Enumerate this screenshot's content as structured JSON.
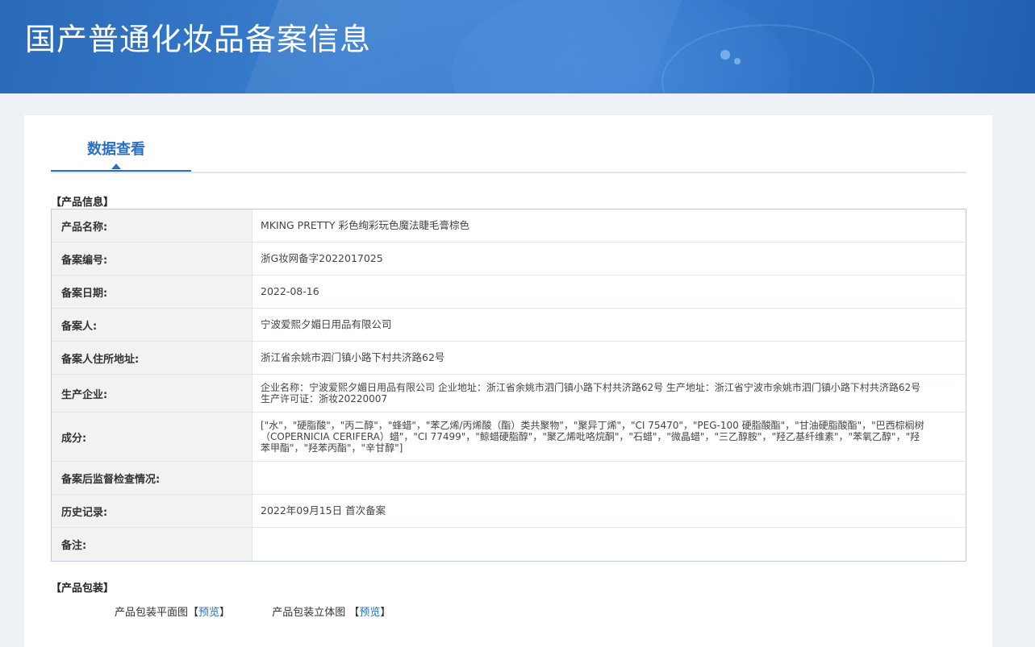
{
  "header": {
    "title": "国产普通化妆品备案信息"
  },
  "tabs": [
    {
      "label": "数据查看",
      "active": true
    }
  ],
  "product_info": {
    "section_title": "【产品信息】",
    "rows": [
      {
        "label": "产品名称:",
        "value": "MKING PRETTY 彩色绚彩玩色魔法睫毛膏棕色"
      },
      {
        "label": "备案编号:",
        "value": "浙G妆网备字2022017025"
      },
      {
        "label": "备案日期:",
        "value": "2022-08-16"
      },
      {
        "label": "备案人:",
        "value": "宁波爱熙夕媚日用品有限公司"
      },
      {
        "label": "备案人住所地址:",
        "value": "浙江省余姚市泗门镇小路下村共济路62号"
      },
      {
        "label": "生产企业:",
        "value": "企业名称：宁波爱熙夕媚日用品有限公司 企业地址：浙江省余姚市泗门镇小路下村共济路62号 生产地址：浙江省宁波市余姚市泗门镇小路下村共济路62号 生产许可证：浙妆20220007"
      },
      {
        "label": "成分:",
        "value": "[\"水\"，\"硬脂酸\"，\"丙二醇\"，\"蜂蜡\"，\"苯乙烯/丙烯酸（酯）类共聚物\"，\"聚异丁烯\"，\"CI 75470\"，\"PEG-100 硬脂酸酯\"，\"甘油硬脂酸酯\"，\"巴西棕榈树（COPERNICIA CERIFERA）蜡\"，\"CI 77499\"，\"鲸蜡硬脂醇\"，\"聚乙烯吡咯烷酮\"，\"石蜡\"，\"微晶蜡\"，\"三乙醇胺\"，\"羟乙基纤维素\"，\"苯氧乙醇\"，\"羟苯甲酯\"，\"羟苯丙酯\"，\"辛甘醇\"]"
      },
      {
        "label": "备案后监督检查情况:",
        "value": ""
      },
      {
        "label": "历史记录:",
        "value": "2022年09月15日 首次备案"
      },
      {
        "label": "备注:",
        "value": ""
      }
    ]
  },
  "packaging": {
    "section_title": "【产品包装】",
    "items": [
      {
        "label": "产品包装平面图",
        "open": "【",
        "link": "预览",
        "close": "】"
      },
      {
        "label": "产品包装立体图 ",
        "open": "【",
        "link": "预览",
        "close": "】"
      }
    ]
  },
  "colors": {
    "header_blue": "#3a7fd0",
    "accent_blue": "#2b6fc4",
    "label_bg": "#f2f2f2",
    "table_border": "#b8cbe2"
  }
}
